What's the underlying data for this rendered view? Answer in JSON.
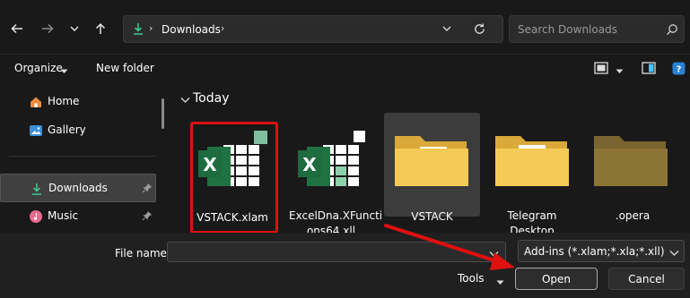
{
  "nav": {
    "location": "Downloads"
  },
  "search": {
    "placeholder": "Search Downloads"
  },
  "cmd": {
    "organize": "Organize",
    "new_folder": "New folder"
  },
  "sidebar": {
    "items": [
      {
        "label": "Home",
        "icon": "home-icon"
      },
      {
        "label": "Gallery",
        "icon": "gallery-icon"
      },
      {
        "label": "Downloads",
        "icon": "download-icon",
        "selected": true,
        "pinned": true
      },
      {
        "label": "Music",
        "icon": "music-icon",
        "pinned": true
      }
    ]
  },
  "group": {
    "label": "Today"
  },
  "files": [
    {
      "name": "VSTACK.xlam",
      "type": "excel-addin",
      "highlighted": true
    },
    {
      "name": "ExcelDna.XFunctions64.xll",
      "line1": "ExcelDna.XFuncti",
      "line2": "ons64.xll",
      "type": "excel-addin"
    },
    {
      "name": "VSTACK",
      "type": "folder",
      "selected": true
    },
    {
      "line1": "Telegram",
      "line2": "Desktop",
      "type": "folder"
    },
    {
      "name": ".opera",
      "type": "folder"
    }
  ],
  "bottom": {
    "filename_label": "File name:",
    "filename_value": "",
    "filter": "Add-ins (*.xlam;*.xla;*.xll)",
    "tools": "Tools",
    "open": "Open",
    "cancel": "Cancel"
  },
  "colors": {
    "accent": "#4cc2ff",
    "highlight": "#e01010",
    "excel": "#1f7244",
    "folder": "#f2c757"
  }
}
